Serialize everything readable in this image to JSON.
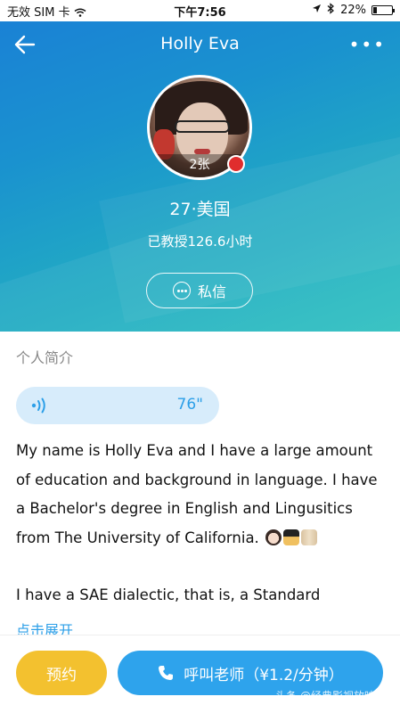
{
  "status_bar": {
    "carrier": "无效 SIM 卡",
    "time": "下午7:56",
    "battery": "22%",
    "battery_level": 0.22
  },
  "nav": {
    "title": "Holly Eva",
    "more": "•••"
  },
  "profile": {
    "photo_count": "2张",
    "age_country": "27·美国",
    "taught_hours": "已教授126.6小时",
    "message_button": "私信"
  },
  "intro": {
    "section_title": "个人简介",
    "voice_duration": "76\"",
    "paragraph1": "My name is Holly Eva and I have a large amount of education and background in language. I have a Bachelor's degree in English and Lingusitics from The University of California.",
    "paragraph2": "I have a SAE dialectic, that is, a Standard",
    "expand": "点击展开"
  },
  "actions": {
    "book": "预约",
    "call": "呼叫老师（¥1.2/分钟）"
  },
  "watermark": "头条 @经典影视放映队",
  "colors": {
    "accent_blue": "#2ea3ec",
    "book_yellow": "#f3c12f",
    "online_red": "#e02d2d"
  }
}
